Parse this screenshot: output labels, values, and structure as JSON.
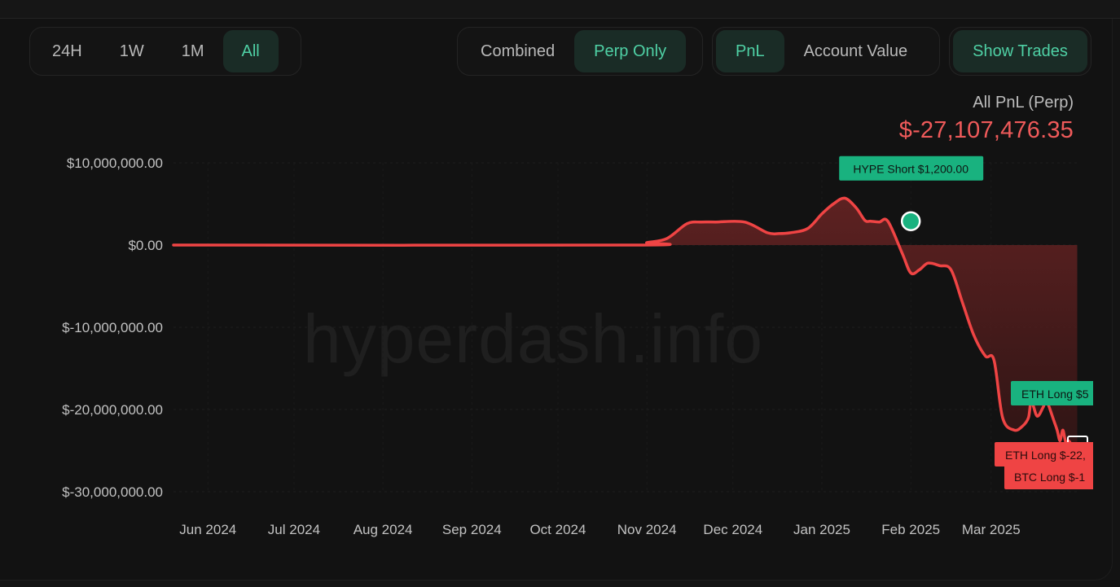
{
  "range_tabs": [
    {
      "label": "24H",
      "active": false
    },
    {
      "label": "1W",
      "active": false
    },
    {
      "label": "1M",
      "active": false
    },
    {
      "label": "All",
      "active": true
    }
  ],
  "mode_tabs": [
    {
      "label": "Combined",
      "active": false
    },
    {
      "label": "Perp Only",
      "active": true
    }
  ],
  "metric_tabs": [
    {
      "label": "PnL",
      "active": true
    },
    {
      "label": "Account Value",
      "active": false
    }
  ],
  "show_trades_label": "Show Trades",
  "summary": {
    "label": "All PnL (Perp)",
    "value": "$-27,107,476.35"
  },
  "watermark": "hyperdash.info",
  "colors": {
    "line": "#ef4444",
    "fill": "#5a2222",
    "accent": "#4fd1a5",
    "short_tag": "#19b27f",
    "long_loss_tag": "#ef4444"
  },
  "chart_data": {
    "type": "area",
    "ylim": [
      -30000000,
      10000000
    ],
    "yticks": [
      10000000,
      0,
      -10000000,
      -20000000,
      -30000000
    ],
    "ytick_labels": [
      "$10,000,000.00",
      "$0.00",
      "$-10,000,000.00",
      "$-20,000,000.00",
      "$-30,000,000.00"
    ],
    "xlim": [
      "2024-05-20",
      "2025-04-01"
    ],
    "xticks": [
      "2024-06-01",
      "2024-07-01",
      "2024-08-01",
      "2024-09-01",
      "2024-10-01",
      "2024-11-01",
      "2024-12-01",
      "2025-01-01",
      "2025-02-01",
      "2025-03-01"
    ],
    "xtick_labels": [
      "Jun 2024",
      "Jul 2024",
      "Aug 2024",
      "Sep 2024",
      "Oct 2024",
      "Nov 2024",
      "Dec 2024",
      "Jan 2025",
      "Feb 2025",
      "Mar 2025"
    ],
    "series": [
      {
        "x": [
          "2024-05-20",
          "2024-10-27",
          "2024-11-01",
          "2024-11-08",
          "2024-11-15",
          "2024-11-20",
          "2024-11-25",
          "2024-12-05",
          "2024-12-13",
          "2024-12-17",
          "2024-12-21",
          "2024-12-27",
          "2025-01-01",
          "2025-01-05",
          "2025-01-09",
          "2025-01-13",
          "2025-01-16",
          "2025-01-18",
          "2025-01-21",
          "2025-01-24",
          "2025-01-29",
          "2025-02-01",
          "2025-02-04",
          "2025-02-07",
          "2025-02-11",
          "2025-02-15",
          "2025-02-19",
          "2025-02-23",
          "2025-02-27",
          "2025-03-02",
          "2025-03-05",
          "2025-03-09",
          "2025-03-12",
          "2025-03-14",
          "2025-03-15",
          "2025-03-17",
          "2025-03-19",
          "2025-03-20",
          "2025-03-21",
          "2025-03-23",
          "2025-03-24",
          "2025-03-25",
          "2025-03-26",
          "2025-03-27",
          "2025-03-28",
          "2025-03-29",
          "2025-03-31"
        ],
        "y": [
          0,
          0,
          300000,
          800000,
          2600000,
          2800000,
          2800000,
          2800000,
          1500000,
          1400000,
          1500000,
          2000000,
          3800000,
          5000000,
          5700000,
          4500000,
          3000000,
          2900000,
          2800000,
          2900000,
          -1000000,
          -3400000,
          -3000000,
          -2200000,
          -2500000,
          -3000000,
          -7000000,
          -11000000,
          -13500000,
          -14000000,
          -21000000,
          -22500000,
          -22000000,
          -21000000,
          -19000000,
          -20800000,
          -19800000,
          -19000000,
          -19500000,
          -21500000,
          -22500000,
          -23800000,
          -22500000,
          -24000000,
          -23800000,
          -24200000,
          -24200000
        ]
      }
    ],
    "trade_markers": [
      {
        "label": "HYPE Short $1,200.00",
        "x": "2025-02-01",
        "y": 2900000,
        "kind": "short"
      },
      {
        "label": "ETH Long $5",
        "kind": "long"
      },
      {
        "label": "ETH Long $-22,",
        "kind": "long-loss"
      },
      {
        "label": "BTC Long $-1",
        "kind": "long-loss"
      }
    ]
  }
}
